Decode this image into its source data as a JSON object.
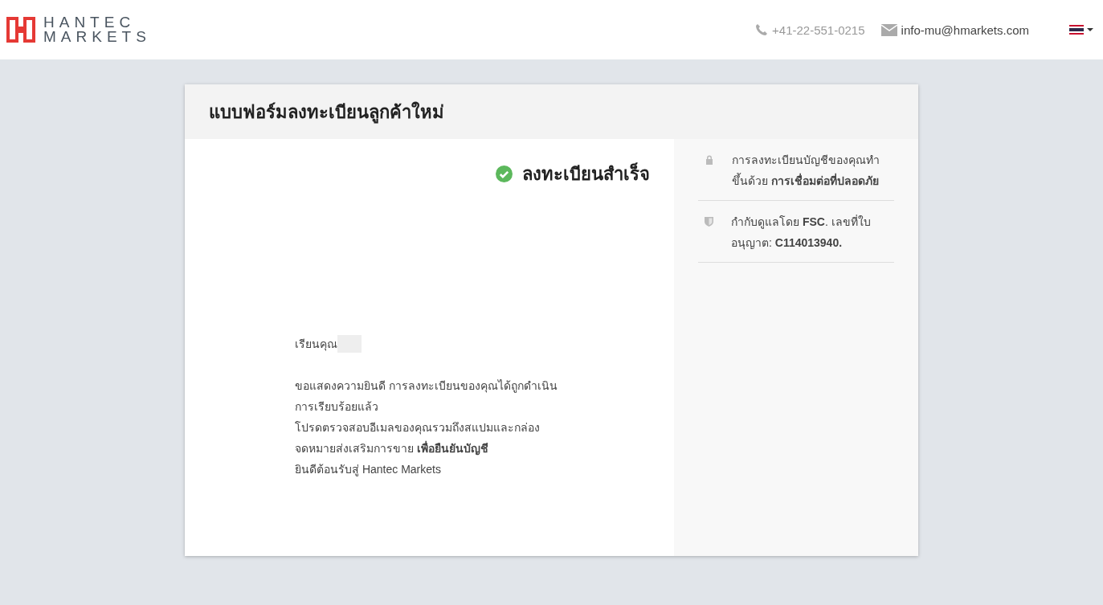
{
  "header": {
    "logo": {
      "line_1": "HANTEC",
      "line_2": "MARKETS"
    },
    "phone": "+41-22-551-0215",
    "email": "info-mu@hmarkets.com"
  },
  "card": {
    "title": "แบบฟอร์มลงทะเบียนลูกค้าใหม่",
    "status": "ลงทะเบียนสำเร็จ",
    "greeting": "เรียนคุณ",
    "paragraphs": [
      "ขอแสดงความยินดี การลงทะเบียนของคุณได้ถูกดำเนินการเรียบร้อยแล้ว",
      "โปรดตรวจสอบอีเมลของคุณรวมถึงสแปมและกล่องจดหมายส่งเสริมการขาย **เพื่อยืนยันบัญชี**"
    ],
    "closing": "ยินดีต้อนรับสู่ Hantec Markets",
    "sidebar": [
      {
        "kind": "lock",
        "text": "การลงทะเบียนบัญชีของคุณทำขึ้นด้วย **การเชื่อมต่อที่ปลอดภัย**"
      },
      {
        "kind": "shield",
        "text": "กำกับดูแลโดย **FSC**. เลขที่ใบอนุญาต: **C114013940.**"
      }
    ]
  }
}
